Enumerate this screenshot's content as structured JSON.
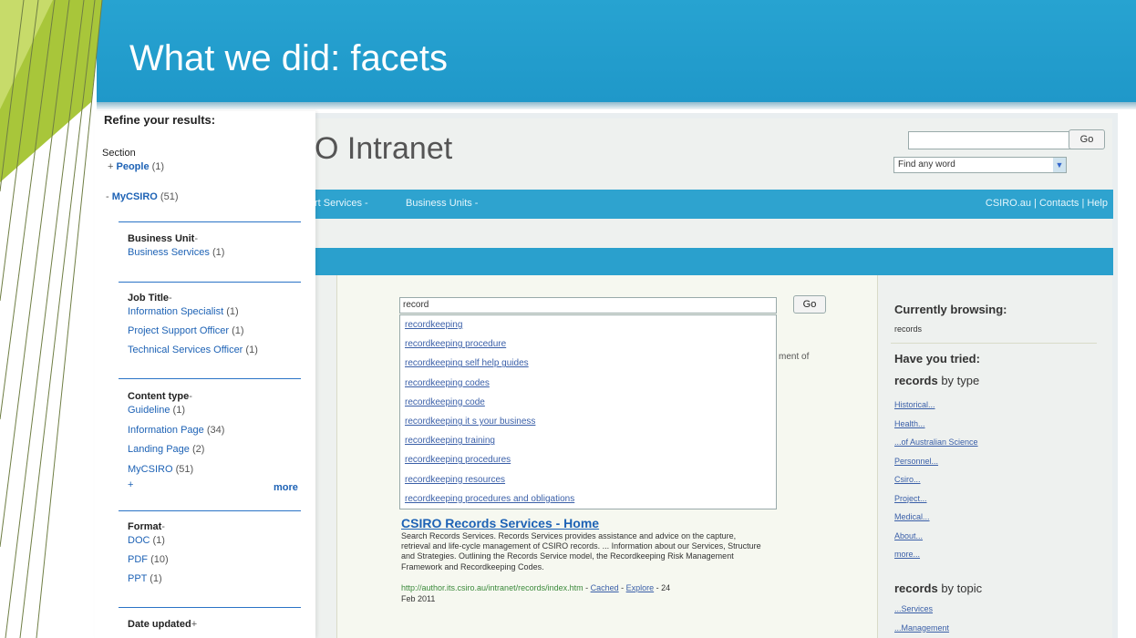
{
  "slide": {
    "title": "What we did: facets"
  },
  "colors": {
    "title_bar": "#27a3d1",
    "accent_green": "#a8c63a",
    "link": "#1d62b5"
  },
  "refine": {
    "heading": "Refine your results:",
    "section_label": "Section",
    "people": {
      "prefix": "+",
      "label": "People",
      "count": "(1)"
    },
    "mycsiro": {
      "prefix": "-",
      "label": "MyCSIRO",
      "count": "(51)"
    },
    "business_unit": {
      "heading": "Business Unit",
      "toggle": "-",
      "items": [
        {
          "label": "Business Services",
          "count": "(1)"
        }
      ]
    },
    "job_title": {
      "heading": "Job Title",
      "toggle": "-",
      "items": [
        {
          "label": "Information Specialist",
          "count": "(1)"
        },
        {
          "label": "Project Support Officer",
          "count": "(1)"
        },
        {
          "label": "Technical Services Officer",
          "count": "(1)"
        }
      ]
    },
    "content_type": {
      "heading": "Content type",
      "toggle": "-",
      "items": [
        {
          "label": "Guideline",
          "count": "(1)"
        },
        {
          "label": "Information Page",
          "count": "(34)"
        },
        {
          "label": "Landing Page",
          "count": "(2)"
        },
        {
          "label": "MyCSIRO",
          "count": "(51)"
        }
      ],
      "more_prefix": "+",
      "more_label": "more"
    },
    "format": {
      "heading": "Format",
      "toggle": "-",
      "items": [
        {
          "label": "DOC",
          "count": "(1)"
        },
        {
          "label": "PDF",
          "count": "(10)"
        },
        {
          "label": "PPT",
          "count": "(1)"
        }
      ]
    },
    "date_updated": {
      "heading": "Date updated",
      "toggle": "+"
    }
  },
  "intranet": {
    "brand": "O Intranet",
    "top_go": "Go",
    "find_select": "Find any word",
    "nav_left_1": "rt Services -",
    "nav_left_2": "Business Units -",
    "nav_right": "CSIRO.au  |  Contacts  |  Help",
    "search_value": "record",
    "search_go": "Go",
    "suggestions": [
      "recordkeeping",
      "recordkeeping procedure",
      "recordkeeping self help guides",
      "recordkeeping codes",
      "recordkeeping code",
      "recordkeeping it s your business",
      "recordkeeping training",
      "recordkeeping procedures",
      "recordkeeping resources",
      "recordkeeping procedures and obligations"
    ],
    "partial_text": "ment of",
    "result": {
      "title": "CSIRO Records Services - Home",
      "snippet": "Search Records Services. Records Services provides assistance and advice on the capture, retrieval and life-cycle management of CSIRO records. ... Information about our Services, Structure and Strategies. Outlining the Records Service model, the Recordkeeping Risk Management Framework and Recordkeeping Codes.",
      "url": "http://author.its.csiro.au/intranet/records/index.htm",
      "sep1": " - ",
      "cached": "Cached",
      "sep2": " - ",
      "explore": "Explore",
      "date_tail": " - 24",
      "date": "Feb 2011"
    },
    "right": {
      "currently_browsing": "Currently browsing:",
      "browsing_value": "records",
      "have_you_tried": "Have you tried:",
      "by_type_bold": "records",
      "by_type_rest": " by type",
      "type_links": [
        "Historical...",
        "Health...",
        "...of Australian Science",
        "Personnel...",
        "Csiro...",
        "Project...",
        "Medical...",
        "About...",
        "more..."
      ],
      "by_topic_bold": "records",
      "by_topic_rest": " by topic",
      "topic_links": [
        "...Services",
        "...Management"
      ]
    }
  }
}
